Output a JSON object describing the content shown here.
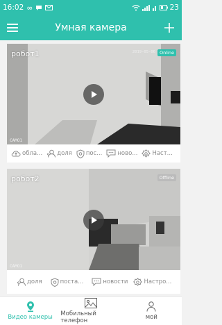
{
  "status_bar": {
    "time": "16:02",
    "battery": "23"
  },
  "app": {
    "title": "Умная камера",
    "accent": "#2fc0ad"
  },
  "cameras": [
    {
      "name": "робот1",
      "status": "Online",
      "timestamp": "2019-05-06",
      "cam_label": "CAMO1",
      "actions": [
        {
          "icon": "cloud-icon",
          "label": "обла..."
        },
        {
          "icon": "share-user-icon",
          "label": "доля"
        },
        {
          "icon": "shield-icon",
          "label": "пос..."
        },
        {
          "icon": "message-icon",
          "label": "ново..."
        },
        {
          "icon": "gear-icon",
          "label": "Наст..."
        }
      ]
    },
    {
      "name": "робот2",
      "status": "Offline",
      "cam_label": "CAMO1",
      "actions": [
        {
          "icon": "share-user-icon",
          "label": "доля"
        },
        {
          "icon": "shield-icon",
          "label": "поста..."
        },
        {
          "icon": "message-icon",
          "label": "новости"
        },
        {
          "icon": "gear-icon",
          "label": "Настро..."
        }
      ]
    }
  ],
  "bottom_nav": [
    {
      "icon": "camera-pin-icon",
      "label": "Видео камеры",
      "active": true
    },
    {
      "icon": "gallery-icon",
      "label": "Мобильный телефон",
      "active": false
    },
    {
      "icon": "person-icon",
      "label": "мой",
      "active": false
    }
  ]
}
